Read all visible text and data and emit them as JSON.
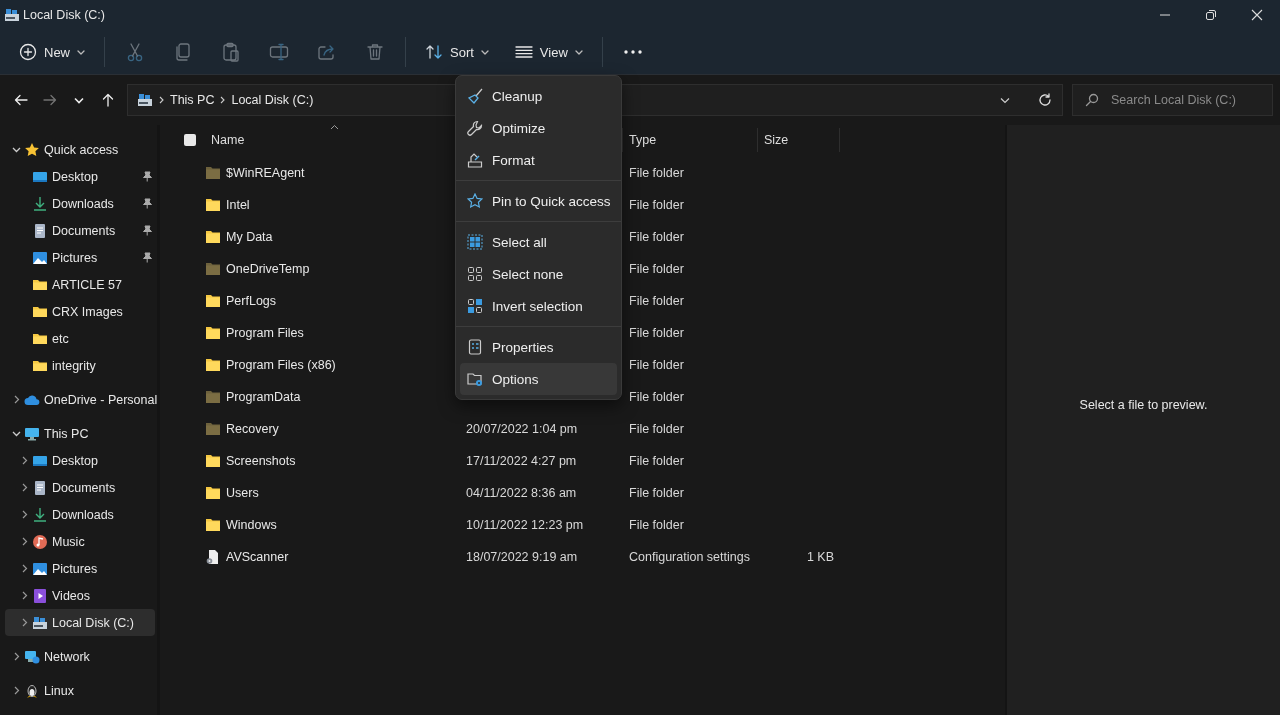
{
  "window": {
    "title": "Local Disk (C:)"
  },
  "toolbar": {
    "groups": [
      [
        {
          "label": "New",
          "dropdown": true,
          "disabled": false
        }
      ],
      [
        {
          "disabled": true
        },
        {
          "disabled": true
        },
        {
          "disabled": true
        },
        {
          "disabled": true
        },
        {
          "disabled": true
        },
        {
          "disabled": true
        }
      ],
      [
        {
          "label": "Sort",
          "dropdown": true,
          "disabled": false
        },
        {
          "label": "View",
          "dropdown": true,
          "disabled": false
        }
      ],
      [
        {
          "disabled": false
        }
      ]
    ]
  },
  "nav": {
    "buttons": [
      {
        "disabled": false
      },
      {
        "disabled": true
      },
      {
        "disabled": false
      },
      {
        "disabled": false
      }
    ]
  },
  "address": {
    "crumbs": [
      "This PC",
      "Local Disk (C:)"
    ]
  },
  "search": {
    "placeholder": "Search Local Disk (C:)"
  },
  "sidebar": {
    "items": [
      {
        "label": "Quick access",
        "expanded": true,
        "selected": false,
        "children": [
          {
            "label": "Desktop",
            "pinned": true,
            "selected": false
          },
          {
            "label": "Downloads",
            "pinned": true,
            "selected": false
          },
          {
            "label": "Documents",
            "pinned": true,
            "selected": false
          },
          {
            "label": "Pictures",
            "pinned": true,
            "selected": false
          },
          {
            "label": "ARTICLE 57",
            "pinned": false,
            "selected": false
          },
          {
            "label": "CRX Images",
            "pinned": false,
            "selected": false
          },
          {
            "label": "etc",
            "pinned": false,
            "selected": false
          },
          {
            "label": "integrity",
            "pinned": false,
            "selected": false
          }
        ]
      },
      {
        "label": "OneDrive - Personal",
        "expanded": false,
        "selected": false
      },
      {
        "label": "This PC",
        "expanded": true,
        "selected": false,
        "children": [
          {
            "label": "Desktop",
            "expanded": false,
            "selected": false
          },
          {
            "label": "Documents",
            "expanded": false,
            "selected": false
          },
          {
            "label": "Downloads",
            "expanded": false,
            "selected": false
          },
          {
            "label": "Music",
            "expanded": false,
            "selected": false
          },
          {
            "label": "Pictures",
            "expanded": false,
            "selected": false
          },
          {
            "label": "Videos",
            "expanded": false,
            "selected": false
          },
          {
            "label": "Local Disk (C:)",
            "expanded": false,
            "selected": true
          }
        ]
      },
      {
        "label": "Network",
        "expanded": false,
        "selected": false
      },
      {
        "label": "Linux",
        "expanded": false,
        "selected": false
      }
    ]
  },
  "table": {
    "columns": [
      {
        "label": "Name",
        "sorted": true
      },
      {
        "label": "Type"
      },
      {
        "label": "Size"
      }
    ],
    "select_all": {
      "checked": false
    },
    "rows": [
      {
        "name": "$WinREAgent",
        "kind": "folder",
        "hidden": true,
        "type": "File folder"
      },
      {
        "name": "Intel",
        "kind": "folder",
        "hidden": false,
        "type": "File folder"
      },
      {
        "name": "My Data",
        "kind": "folder",
        "hidden": false,
        "type": "File folder"
      },
      {
        "name": "OneDriveTemp",
        "kind": "folder",
        "hidden": true,
        "type": "File folder"
      },
      {
        "name": "PerfLogs",
        "kind": "folder",
        "hidden": false,
        "type": "File folder"
      },
      {
        "name": "Program Files",
        "kind": "folder",
        "hidden": false,
        "type": "File folder"
      },
      {
        "name": "Program Files (x86)",
        "kind": "folder",
        "hidden": false,
        "type": "File folder"
      },
      {
        "name": "ProgramData",
        "kind": "folder",
        "hidden": true,
        "type": "File folder"
      },
      {
        "name": "Recovery",
        "kind": "folder",
        "hidden": true,
        "date": "20/07/2022 1:04 pm",
        "type": "File folder"
      },
      {
        "name": "Screenshots",
        "kind": "folder",
        "hidden": false,
        "date": "17/11/2022 4:27 pm",
        "type": "File folder"
      },
      {
        "name": "Users",
        "kind": "folder",
        "hidden": false,
        "date": "04/11/2022 8:36 am",
        "type": "File folder"
      },
      {
        "name": "Windows",
        "kind": "folder",
        "hidden": false,
        "date": "10/11/2022 12:23 pm",
        "type": "File folder"
      },
      {
        "name": "AVScanner",
        "kind": "file",
        "hidden": false,
        "date": "18/07/2022 9:19 am",
        "type": "Configuration settings",
        "size": "1 KB"
      }
    ]
  },
  "preview": {
    "message": "Select a file to preview."
  },
  "menu": {
    "groups": [
      [
        {
          "label": "Cleanup",
          "selected": false
        },
        {
          "label": "Optimize",
          "selected": false
        },
        {
          "label": "Format",
          "selected": false
        }
      ],
      [
        {
          "label": "Pin to Quick access",
          "selected": false
        }
      ],
      [
        {
          "label": "Select all",
          "selected": false
        },
        {
          "label": "Select none",
          "selected": false
        },
        {
          "label": "Invert selection",
          "selected": false
        }
      ],
      [
        {
          "label": "Properties",
          "selected": false
        },
        {
          "label": "Options",
          "selected": true
        }
      ]
    ]
  }
}
